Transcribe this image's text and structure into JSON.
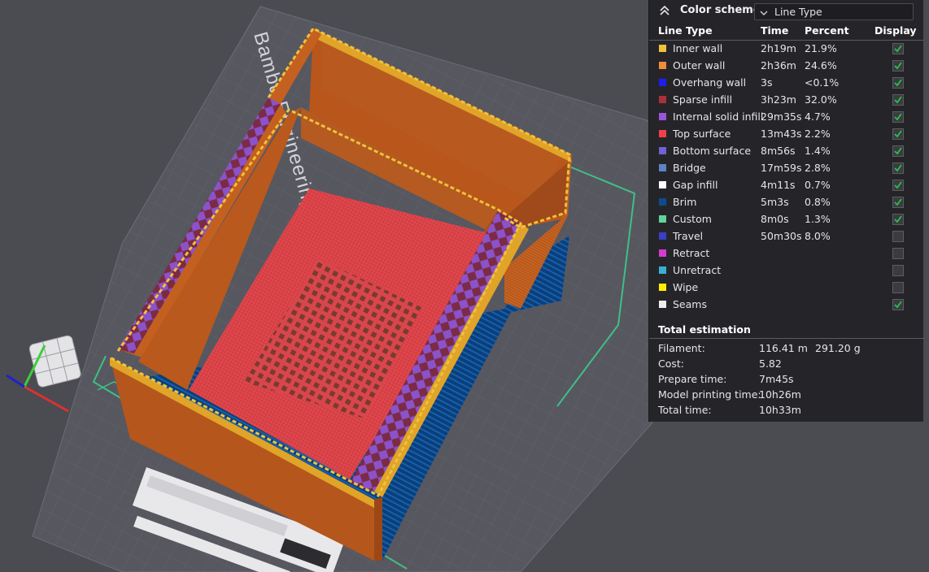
{
  "plate_label": "Bambu Engineering Plate",
  "color_scheme": {
    "title": "Color scheme",
    "selected": "Line Type"
  },
  "columns": {
    "line_type": "Line Type",
    "time": "Time",
    "percent": "Percent",
    "display": "Display"
  },
  "rows": [
    {
      "name": "Inner wall",
      "time": "2h19m",
      "percent": "21.9%",
      "color": "#f0c23a",
      "display": true
    },
    {
      "name": "Outer wall",
      "time": "2h36m",
      "percent": "24.6%",
      "color": "#f08c3a",
      "display": true
    },
    {
      "name": "Overhang wall",
      "time": "3s",
      "percent": "<0.1%",
      "color": "#1d1df5",
      "display": true
    },
    {
      "name": "Sparse infill",
      "time": "3h23m",
      "percent": "32.0%",
      "color": "#a8323b",
      "display": true
    },
    {
      "name": "Internal solid infill",
      "time": "29m35s",
      "percent": "4.7%",
      "color": "#9b55d8",
      "display": true
    },
    {
      "name": "Top surface",
      "time": "13m43s",
      "percent": "2.2%",
      "color": "#f0414a",
      "display": true
    },
    {
      "name": "Bottom surface",
      "time": "8m56s",
      "percent": "1.4%",
      "color": "#6e62d6",
      "display": true
    },
    {
      "name": "Bridge",
      "time": "17m59s",
      "percent": "2.8%",
      "color": "#5b84c6",
      "display": true
    },
    {
      "name": "Gap infill",
      "time": "4m11s",
      "percent": "0.7%",
      "color": "#ffffff",
      "display": true
    },
    {
      "name": "Brim",
      "time": "5m3s",
      "percent": "0.8%",
      "color": "#0f4b8c",
      "display": true
    },
    {
      "name": "Custom",
      "time": "8m0s",
      "percent": "1.3%",
      "color": "#5ed49a",
      "display": true
    },
    {
      "name": "Travel",
      "time": "50m30s",
      "percent": "8.0%",
      "color": "#3a3fc4",
      "display": false
    },
    {
      "name": "Retract",
      "time": "",
      "percent": "",
      "color": "#d63ad0",
      "display": false
    },
    {
      "name": "Unretract",
      "time": "",
      "percent": "",
      "color": "#3ab0d0",
      "display": false
    },
    {
      "name": "Wipe",
      "time": "",
      "percent": "",
      "color": "#ffee00",
      "display": false
    },
    {
      "name": "Seams",
      "time": "",
      "percent": "",
      "color": "#eeeeee",
      "display": true
    }
  ],
  "total": {
    "title": "Total estimation",
    "items": [
      {
        "label": "Filament:",
        "value": "116.41 m",
        "value2": "291.20 g"
      },
      {
        "label": "Cost:",
        "value": "5.82",
        "value2": ""
      },
      {
        "label": "Prepare time:",
        "value": "7m45s",
        "value2": ""
      },
      {
        "label": "Model printing time:",
        "value": "10h26m",
        "value2": ""
      },
      {
        "label": "Total time:",
        "value": "10h33m",
        "value2": ""
      }
    ]
  }
}
